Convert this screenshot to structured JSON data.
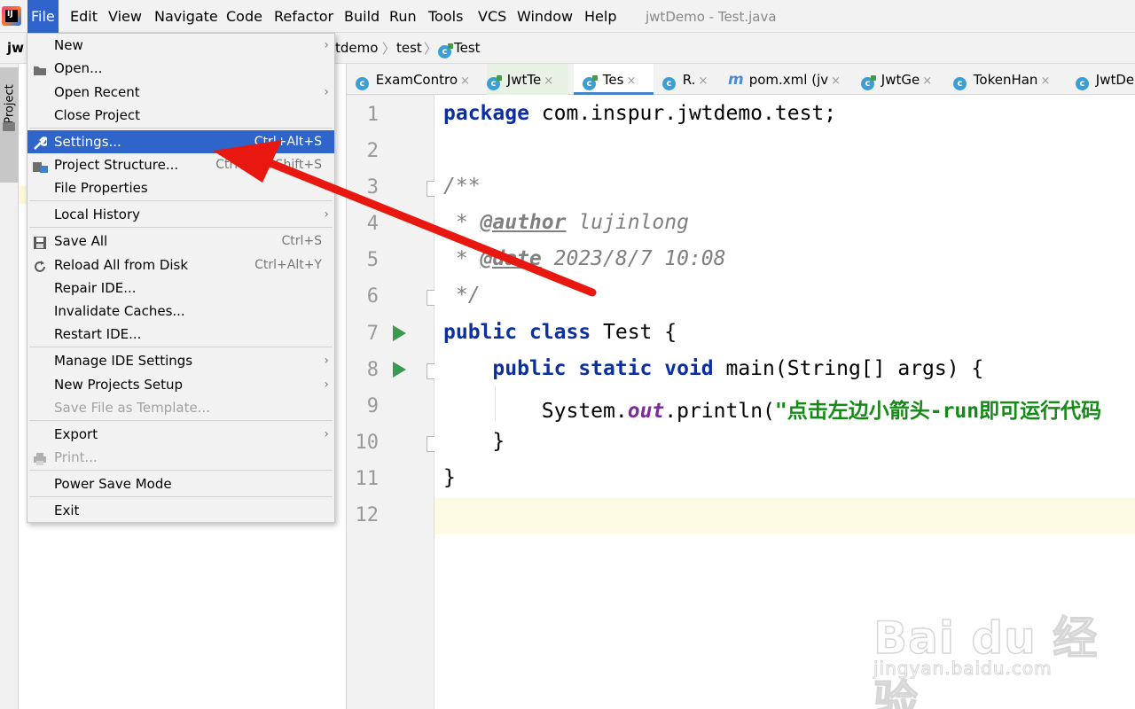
{
  "menubar": {
    "items": [
      "File",
      "Edit",
      "View",
      "Navigate",
      "Code",
      "Refactor",
      "Build",
      "Run",
      "Tools",
      "VCS",
      "Window",
      "Help"
    ],
    "window_title": "jwtDemo - Test.java"
  },
  "breadcrumb": {
    "project": "jw",
    "partial": "tdemo",
    "folder": "test",
    "file": "Test"
  },
  "tool_strip": {
    "project_label": "Project"
  },
  "tabs": [
    {
      "label": "ExamContro",
      "icon": "class-icon"
    },
    {
      "label": "JwtTe",
      "icon": "test-class-icon"
    },
    {
      "label": "Tes",
      "icon": "test-class-icon",
      "active": true
    },
    {
      "label": "R.",
      "icon": "class-icon"
    },
    {
      "label": "pom.xml (jv",
      "icon": "maven-icon"
    },
    {
      "label": "JwtGe",
      "icon": "test-class-icon"
    },
    {
      "label": "TokenHan",
      "icon": "class-icon"
    },
    {
      "label": "JwtDe",
      "icon": "spring-class-icon"
    }
  ],
  "tab_close_glyph": "×",
  "file_menu": {
    "items": {
      "new": "New",
      "open": "Open...",
      "open_recent": "Open Recent",
      "close_project": "Close Project",
      "settings": "Settings...",
      "settings_shortcut": "Ctrl+Alt+S",
      "project_structure": "Project Structure...",
      "project_structure_shortcut": "Ctrl+Alt+Shift+S",
      "file_properties": "File Properties",
      "local_history": "Local History",
      "save_all": "Save All",
      "save_all_shortcut": "Ctrl+S",
      "reload": "Reload All from Disk",
      "reload_shortcut": "Ctrl+Alt+Y",
      "repair_ide": "Repair IDE...",
      "invalidate": "Invalidate Caches...",
      "restart": "Restart IDE...",
      "manage_settings": "Manage IDE Settings",
      "new_projects_setup": "New Projects Setup",
      "save_as_template": "Save File as Template...",
      "export": "Export",
      "print": "Print...",
      "power_save": "Power Save Mode",
      "exit": "Exit"
    },
    "highlighted": "settings"
  },
  "editor": {
    "line_numbers": [
      "1",
      "2",
      "3",
      "4",
      "5",
      "6",
      "7",
      "8",
      "9",
      "10",
      "11",
      "12"
    ],
    "code": {
      "l1_kw": "package",
      "l1_rest": " com.inspur.jwtdemo.test;",
      "l3": "/**",
      "l4_star": " * ",
      "l4_tag": "@author",
      "l4_val": " lujinlong",
      "l5_star": " * ",
      "l5_tag": "@date",
      "l5_val": " 2023/8/7 10:08",
      "l6": " */",
      "l7_kw": "public class",
      "l7_rest": " Test {",
      "l8_indent": "    ",
      "l8_kw": "public static void",
      "l8_rest": " main(String[] args) {",
      "l9_pre": "        System.",
      "l9_field": "out",
      "l9_mid": ".println(",
      "l9_str": "\"点击左边小箭头-run即可运行代码",
      "l10": "    }",
      "l11": "}"
    }
  },
  "watermark": {
    "main": "Bai du 经验",
    "sub": "jingyan.baidu.com"
  },
  "annotation": {
    "color": "#e8170f"
  }
}
